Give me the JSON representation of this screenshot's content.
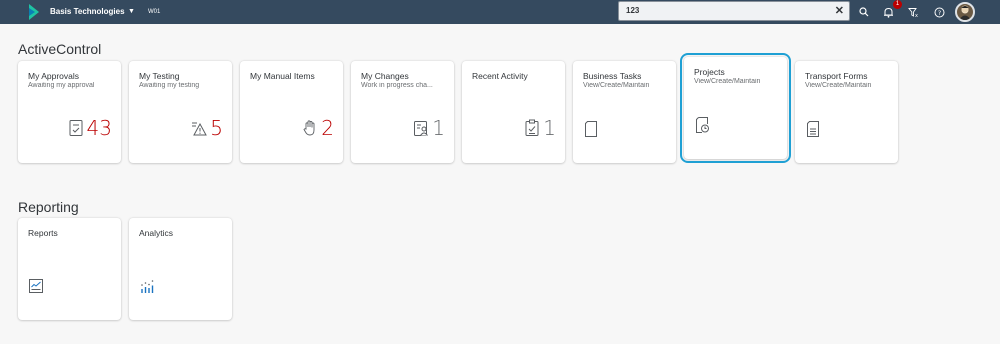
{
  "shell": {
    "brand": "Basis Technologies",
    "system": "W01",
    "search_value": "123",
    "notification_count": "1"
  },
  "colors": {
    "shell_bg": "#354a5f",
    "kpi_red": "#bb0000",
    "kpi_gray": "#6a6d70",
    "focus": "#1fa0d4"
  },
  "groups": [
    {
      "title": "ActiveControl",
      "tiles": [
        {
          "title": "My Approvals",
          "subtitle": "Awaiting my approval",
          "value": "43",
          "icon": "approval-doc-icon"
        },
        {
          "title": "My Testing",
          "subtitle": "Awaiting my testing",
          "value": "5",
          "icon": "warning-list-icon"
        },
        {
          "title": "My Manual Items",
          "subtitle": "",
          "value": "2",
          "icon": "hand-icon"
        },
        {
          "title": "My Changes",
          "subtitle": "Work in progress cha...",
          "value": "1",
          "icon": "user-list-icon"
        },
        {
          "title": "Recent Activity",
          "subtitle": "",
          "value": "1",
          "icon": "clipboard-check-icon"
        },
        {
          "title": "Business Tasks",
          "subtitle": "View/Create/Maintain",
          "icon": "document-icon"
        },
        {
          "title": "Projects",
          "subtitle": "View/Create/Maintain",
          "icon": "document-clock-icon"
        },
        {
          "title": "Transport Forms",
          "subtitle": "View/Create/Maintain",
          "icon": "form-document-icon"
        }
      ]
    },
    {
      "title": "Reporting",
      "tiles": [
        {
          "title": "Reports",
          "icon": "report-icon"
        },
        {
          "title": "Analytics",
          "icon": "analytics-icon"
        }
      ]
    }
  ]
}
